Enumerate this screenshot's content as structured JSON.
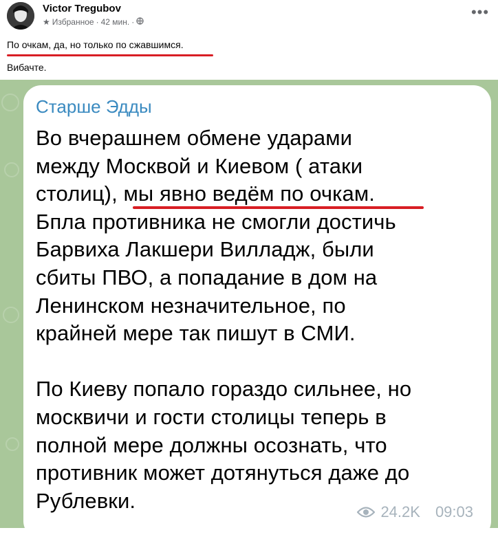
{
  "post": {
    "author": "Victor Tregubov",
    "audience": "Избранное",
    "time": "42 мин.",
    "caption_line1": "По очкам, да, но только по сжавшимся.",
    "caption_line2": "Вибачте.",
    "more_icon": "more-horizontal-icon"
  },
  "telegram": {
    "channel": "Старше Эдды",
    "message": "Во вчерашнем обмене ударами\nмежду Москвой и Киевом ( атаки\nстолиц), мы явно ведём по очкам.\nБпла противника не смогли достичь\nБарвиха Лакшери Вилладж, были\nсбиты ПВО, а попадание в дом на\nЛенинском незначительное, по\nкрайней мере так пишут в СМИ.\n\nПо Киеву попало гораздо сильнее, но\nмосквичи и гости столицы теперь в\nполной мере должны осознать, что\nпротивник может дотянуться даже до\nРублевки.",
    "views": "24.2K",
    "time": "09:03"
  },
  "colors": {
    "underline": "#d81e24",
    "channel": "#3a8ac0",
    "background": "#a9c79a"
  }
}
